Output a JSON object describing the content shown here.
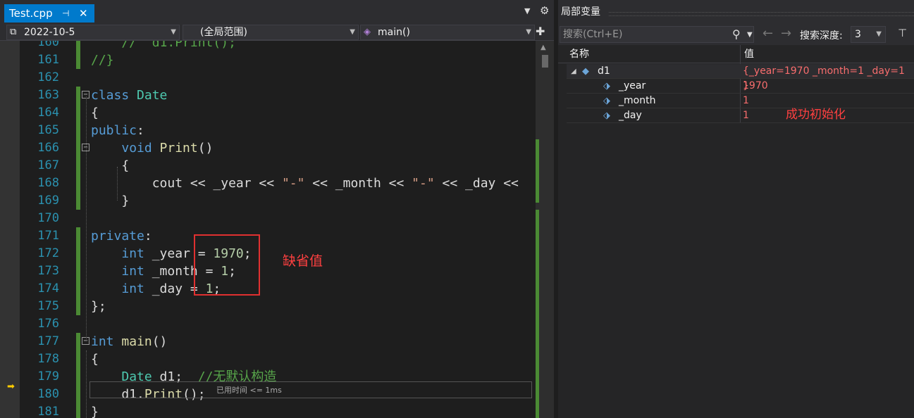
{
  "editor": {
    "tab": {
      "filename": "Test.cpp",
      "pin_icon": "⊣",
      "close_icon": "✕"
    },
    "navbar": {
      "project": "2022-10-5",
      "scope": "(全局范围)",
      "member": "main()"
    },
    "elapsed_note": "已用时间 <= 1ms",
    "annotation_default": "缺省值",
    "lines": [
      {
        "num": "160",
        "code": [
          {
            "t": "    //  d1.Print();",
            "c": "cm"
          }
        ]
      },
      {
        "num": "161",
        "code": [
          {
            "t": "//}",
            "c": "cm"
          }
        ]
      },
      {
        "num": "162",
        "code": []
      },
      {
        "num": "163",
        "code": [
          {
            "t": "class ",
            "c": "kw"
          },
          {
            "t": "Date",
            "c": "ty"
          }
        ]
      },
      {
        "num": "164",
        "code": [
          {
            "t": "{",
            "c": ""
          }
        ]
      },
      {
        "num": "165",
        "code": [
          {
            "t": "public",
            "c": "kw"
          },
          {
            "t": ":",
            "c": ""
          }
        ]
      },
      {
        "num": "166",
        "code": [
          {
            "t": "    ",
            "c": ""
          },
          {
            "t": "void ",
            "c": "kw"
          },
          {
            "t": "Print",
            "c": "fn"
          },
          {
            "t": "()",
            "c": ""
          }
        ]
      },
      {
        "num": "167",
        "code": [
          {
            "t": "    {",
            "c": ""
          }
        ]
      },
      {
        "num": "168",
        "code": [
          {
            "t": "        cout << _year << ",
            "c": ""
          },
          {
            "t": "\"-\"",
            "c": "str"
          },
          {
            "t": " << _month << ",
            "c": ""
          },
          {
            "t": "\"-\"",
            "c": "str"
          },
          {
            "t": " << _day <<",
            "c": ""
          }
        ]
      },
      {
        "num": "169",
        "code": [
          {
            "t": "    }",
            "c": ""
          }
        ]
      },
      {
        "num": "170",
        "code": []
      },
      {
        "num": "171",
        "code": [
          {
            "t": "private",
            "c": "kw"
          },
          {
            "t": ":",
            "c": ""
          }
        ]
      },
      {
        "num": "172",
        "code": [
          {
            "t": "    ",
            "c": ""
          },
          {
            "t": "int ",
            "c": "kw"
          },
          {
            "t": "_year = ",
            "c": ""
          },
          {
            "t": "1970",
            "c": "num"
          },
          {
            "t": ";",
            "c": ""
          }
        ]
      },
      {
        "num": "173",
        "code": [
          {
            "t": "    ",
            "c": ""
          },
          {
            "t": "int ",
            "c": "kw"
          },
          {
            "t": "_month = ",
            "c": ""
          },
          {
            "t": "1",
            "c": "num"
          },
          {
            "t": ";",
            "c": ""
          }
        ]
      },
      {
        "num": "174",
        "code": [
          {
            "t": "    ",
            "c": ""
          },
          {
            "t": "int ",
            "c": "kw"
          },
          {
            "t": "_day = ",
            "c": ""
          },
          {
            "t": "1",
            "c": "num"
          },
          {
            "t": ";",
            "c": ""
          }
        ]
      },
      {
        "num": "175",
        "code": [
          {
            "t": "};",
            "c": ""
          }
        ]
      },
      {
        "num": "176",
        "code": []
      },
      {
        "num": "177",
        "code": [
          {
            "t": "int ",
            "c": "kw"
          },
          {
            "t": "main",
            "c": "fn"
          },
          {
            "t": "()",
            "c": ""
          }
        ]
      },
      {
        "num": "178",
        "code": [
          {
            "t": "{",
            "c": ""
          }
        ]
      },
      {
        "num": "179",
        "code": [
          {
            "t": "    ",
            "c": ""
          },
          {
            "t": "Date ",
            "c": "ty"
          },
          {
            "t": "d1;  ",
            "c": ""
          },
          {
            "t": "//无默认构造",
            "c": "cm"
          }
        ]
      },
      {
        "num": "180",
        "code": [
          {
            "t": "    d1.",
            "c": ""
          },
          {
            "t": "Print",
            "c": "fn"
          },
          {
            "t": "();",
            "c": ""
          }
        ]
      },
      {
        "num": "181",
        "code": [
          {
            "t": "}",
            "c": ""
          }
        ]
      }
    ]
  },
  "locals": {
    "title": "局部变量",
    "search_placeholder": "搜索(Ctrl+E)",
    "depth_label": "搜索深度:",
    "depth_value": "3",
    "col_name": "名称",
    "col_value": "值",
    "rows": [
      {
        "name": "d1",
        "value": "{_year=1970 _month=1 _day=1 }",
        "level": 0
      },
      {
        "name": "_year",
        "value": "1970",
        "level": 1
      },
      {
        "name": "_month",
        "value": "1",
        "level": 1
      },
      {
        "name": "_day",
        "value": "1",
        "level": 1
      }
    ],
    "annotation_success": "成功初始化"
  },
  "colors": {
    "accent": "#007acc",
    "annotation": "#ff4040",
    "changed_value": "#f86d6d"
  }
}
